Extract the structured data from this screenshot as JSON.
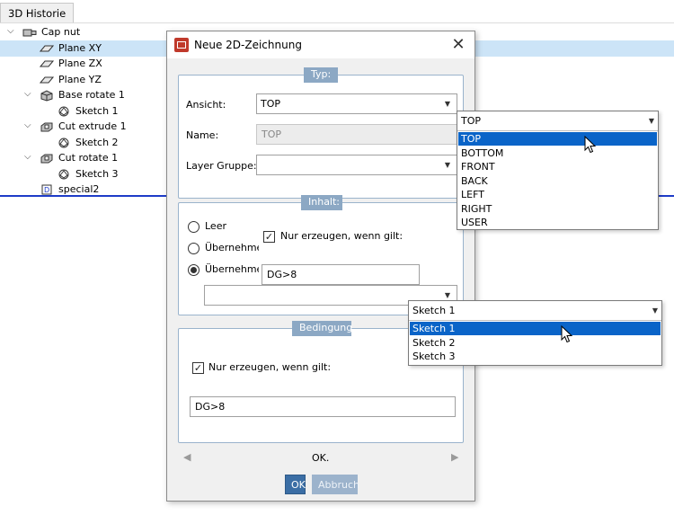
{
  "panel": {
    "tab_label": "3D Historie",
    "tree": [
      {
        "label": "Cap nut",
        "icon": "part-icon",
        "depth": 0,
        "expander": "⌵"
      },
      {
        "label": "Plane XY",
        "icon": "plane-icon",
        "depth": 1,
        "selected": true
      },
      {
        "label": "Plane ZX",
        "icon": "plane-icon",
        "depth": 1
      },
      {
        "label": "Plane YZ",
        "icon": "plane-icon",
        "depth": 1
      },
      {
        "label": "Base rotate 1",
        "icon": "solid-icon",
        "depth": 1,
        "expander": "⌵"
      },
      {
        "label": "Sketch 1",
        "icon": "sketch-icon",
        "depth": 2
      },
      {
        "label": "Cut extrude 1",
        "icon": "cut-icon",
        "depth": 1,
        "expander": "⌵"
      },
      {
        "label": "Sketch 2",
        "icon": "sketch-icon",
        "depth": 2
      },
      {
        "label": "Cut rotate 1",
        "icon": "cut-icon",
        "depth": 1,
        "expander": "⌵"
      },
      {
        "label": "Sketch 3",
        "icon": "sketch-icon",
        "depth": 2
      },
      {
        "label": "special2",
        "icon": "special-icon",
        "depth": 1
      }
    ]
  },
  "dialog": {
    "title": "Neue 2D-Zeichnung",
    "typ": {
      "group_title": "Typ:",
      "ansicht_label": "Ansicht:",
      "ansicht_value": "TOP",
      "name_label": "Name:",
      "name_value": "TOP",
      "layer_label": "Layer Gruppe:",
      "layer_value": ""
    },
    "inhalt": {
      "group_title": "Inhalt:",
      "radio_leer": "Leer",
      "radio_uebernehmen_1": "Übernehme",
      "radio_uebernehmen_2": "Übernehme",
      "checkbox_label": "Nur erzeugen, wenn gilt:",
      "condition_value": "DG>8",
      "combo_value": ""
    },
    "bedingung": {
      "group_title": "Bedingung",
      "checkbox_label": "Nur erzeugen, wenn gilt:",
      "condition_value": "DG>8"
    },
    "nav": {
      "prev": "◀",
      "next": "▶",
      "status": "OK."
    },
    "buttons": {
      "ok": "OK",
      "cancel": "Abbruch"
    }
  },
  "view_dropdown": {
    "current": "TOP",
    "options": [
      "TOP",
      "BOTTOM",
      "FRONT",
      "BACK",
      "LEFT",
      "RIGHT",
      "USER"
    ],
    "highlighted": "TOP"
  },
  "sketch_dropdown": {
    "current": "Sketch 1",
    "options": [
      "Sketch 1",
      "Sketch 2",
      "Sketch 3"
    ],
    "highlighted": "Sketch 1"
  },
  "colors": {
    "selection": "#cce4f7",
    "accent_blue": "#0a64c8",
    "group_header": "#8ca8c4",
    "ok_button": "#3b6ea5",
    "divider": "#1e3cc8"
  }
}
